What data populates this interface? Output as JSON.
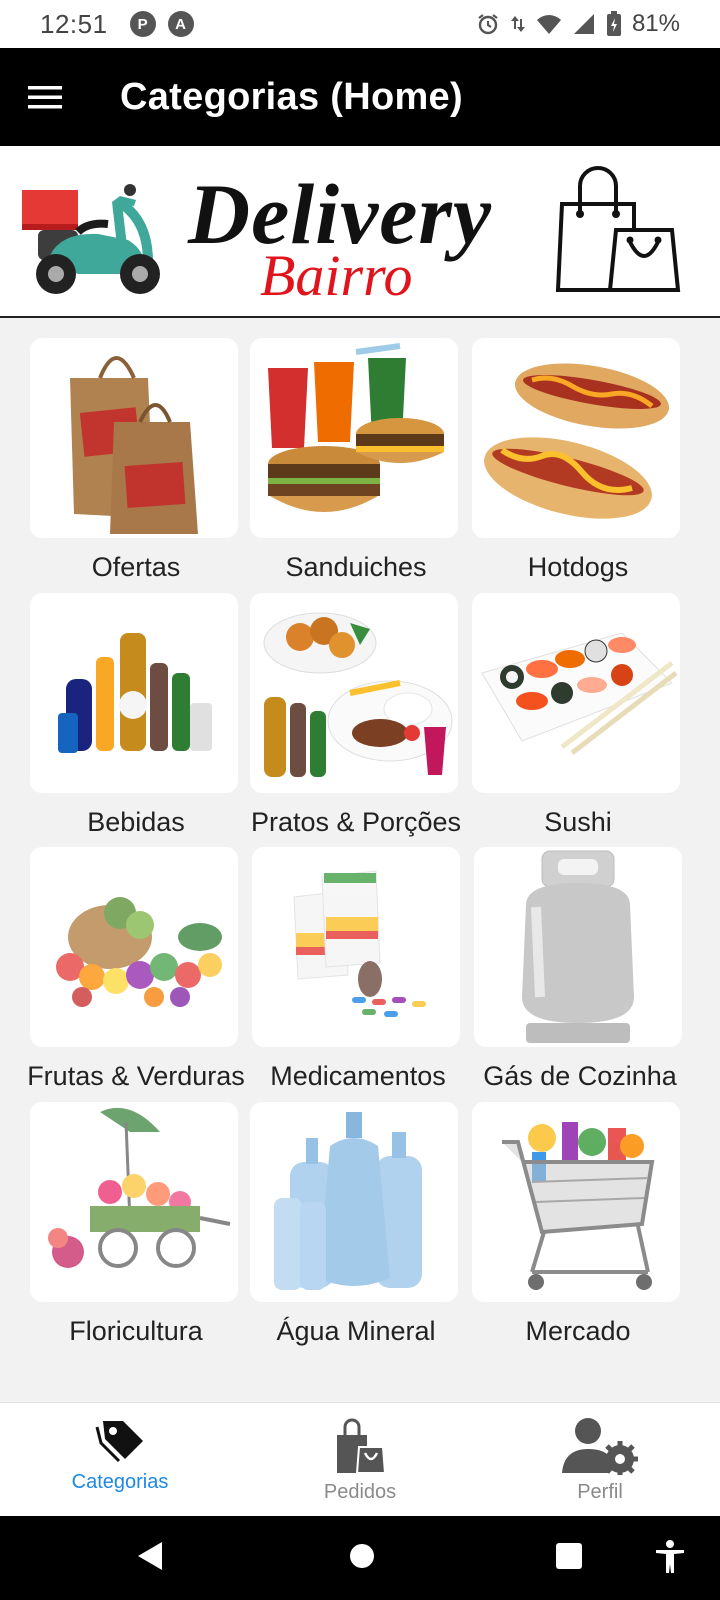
{
  "status_bar": {
    "time": "12:51",
    "battery": "81%",
    "left_icons": [
      "P",
      "A"
    ]
  },
  "app_bar": {
    "title": "Categorias (Home)"
  },
  "banner": {
    "brand_main": "Delivery",
    "brand_sub": "Bairro",
    "brand_sub_color": "#e0141c"
  },
  "categories": [
    {
      "label": "Ofertas",
      "icon": "shopping-bags-image"
    },
    {
      "label": "Sanduiches",
      "icon": "burgers-drinks-image"
    },
    {
      "label": "Hotdogs",
      "icon": "hotdogs-image"
    },
    {
      "label": "Bebidas",
      "icon": "beverage-bottles-image"
    },
    {
      "label": "Pratos & Porções",
      "icon": "plates-portions-image"
    },
    {
      "label": "Sushi",
      "icon": "sushi-platter-image"
    },
    {
      "label": "Frutas & Verduras",
      "icon": "fruits-vegetables-image"
    },
    {
      "label": "Medicamentos",
      "icon": "medicine-boxes-image"
    },
    {
      "label": "Gás de Cozinha",
      "icon": "gas-cylinder-image"
    },
    {
      "label": "Floricultura",
      "icon": "flower-cart-image"
    },
    {
      "label": "Água Mineral",
      "icon": "water-jugs-image"
    },
    {
      "label": "Mercado",
      "icon": "shopping-cart-image"
    }
  ],
  "bottom_nav": {
    "items": [
      {
        "label": "Categorias",
        "icon": "tag-icon",
        "active": true
      },
      {
        "label": "Pedidos",
        "icon": "shopping-bag-icon",
        "active": false
      },
      {
        "label": "Perfil",
        "icon": "user-settings-icon",
        "active": false
      }
    ],
    "active_color": "#1e88e5",
    "inactive_color": "#8a8a8a"
  }
}
